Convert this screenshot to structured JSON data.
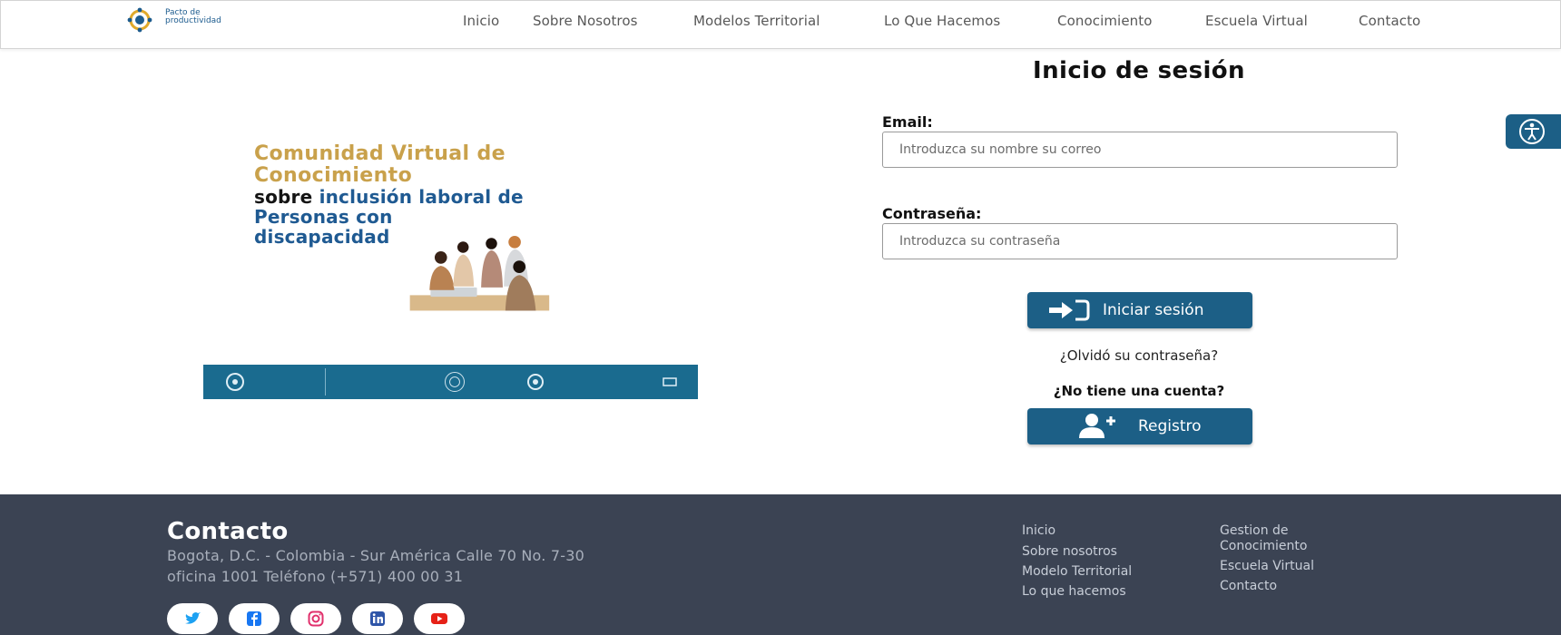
{
  "header": {
    "logo": {
      "line1": "Pacto de",
      "line2": "productividad",
      "tagline": ""
    },
    "nav": [
      "Inicio",
      "Sobre Nosotros",
      "Modelos Territorial",
      "Lo Que Hacemos",
      "Conocimiento",
      "Escuela Virtual",
      "Contacto"
    ]
  },
  "hero": {
    "title_line1": "Comunidad Virtual de",
    "title_line2": "Conocimiento",
    "line3_a": "sobre ",
    "line3_b": "inclusión laboral de",
    "line4": "Personas con",
    "line5": "discapacidad"
  },
  "login": {
    "title": "Inicio de sesión",
    "email_label": "Email:",
    "email_placeholder": "Introduzca su nombre su correo",
    "password_label": "Contraseña:",
    "password_placeholder": "Introduzca su contraseña",
    "login_button": "Iniciar sesión",
    "forgot_link": "¿Olvidó su contraseña?",
    "no_account": "¿No tiene una cuenta?",
    "register_button": "Registro"
  },
  "footer": {
    "title": "Contacto",
    "address_line1": "Bogota, D.C. - Colombia - Sur América Calle 70 No. 7-30",
    "address_line2": "oficina 1001 Teléfono (+571) 400 00 31",
    "links_col1": [
      "Inicio",
      "Sobre nosotros",
      "Modelo Territorial",
      "Lo que hacemos"
    ],
    "links_col2": [
      "Gestion de Conocimiento",
      "Escuela Virtual",
      "Contacto"
    ],
    "social": [
      "twitter-icon",
      "facebook-icon",
      "instagram-icon",
      "linkedin-icon",
      "youtube-icon"
    ]
  },
  "colors": {
    "brand": "#1c5f86",
    "gold": "#c9a14b",
    "footer": "#3b4353"
  }
}
